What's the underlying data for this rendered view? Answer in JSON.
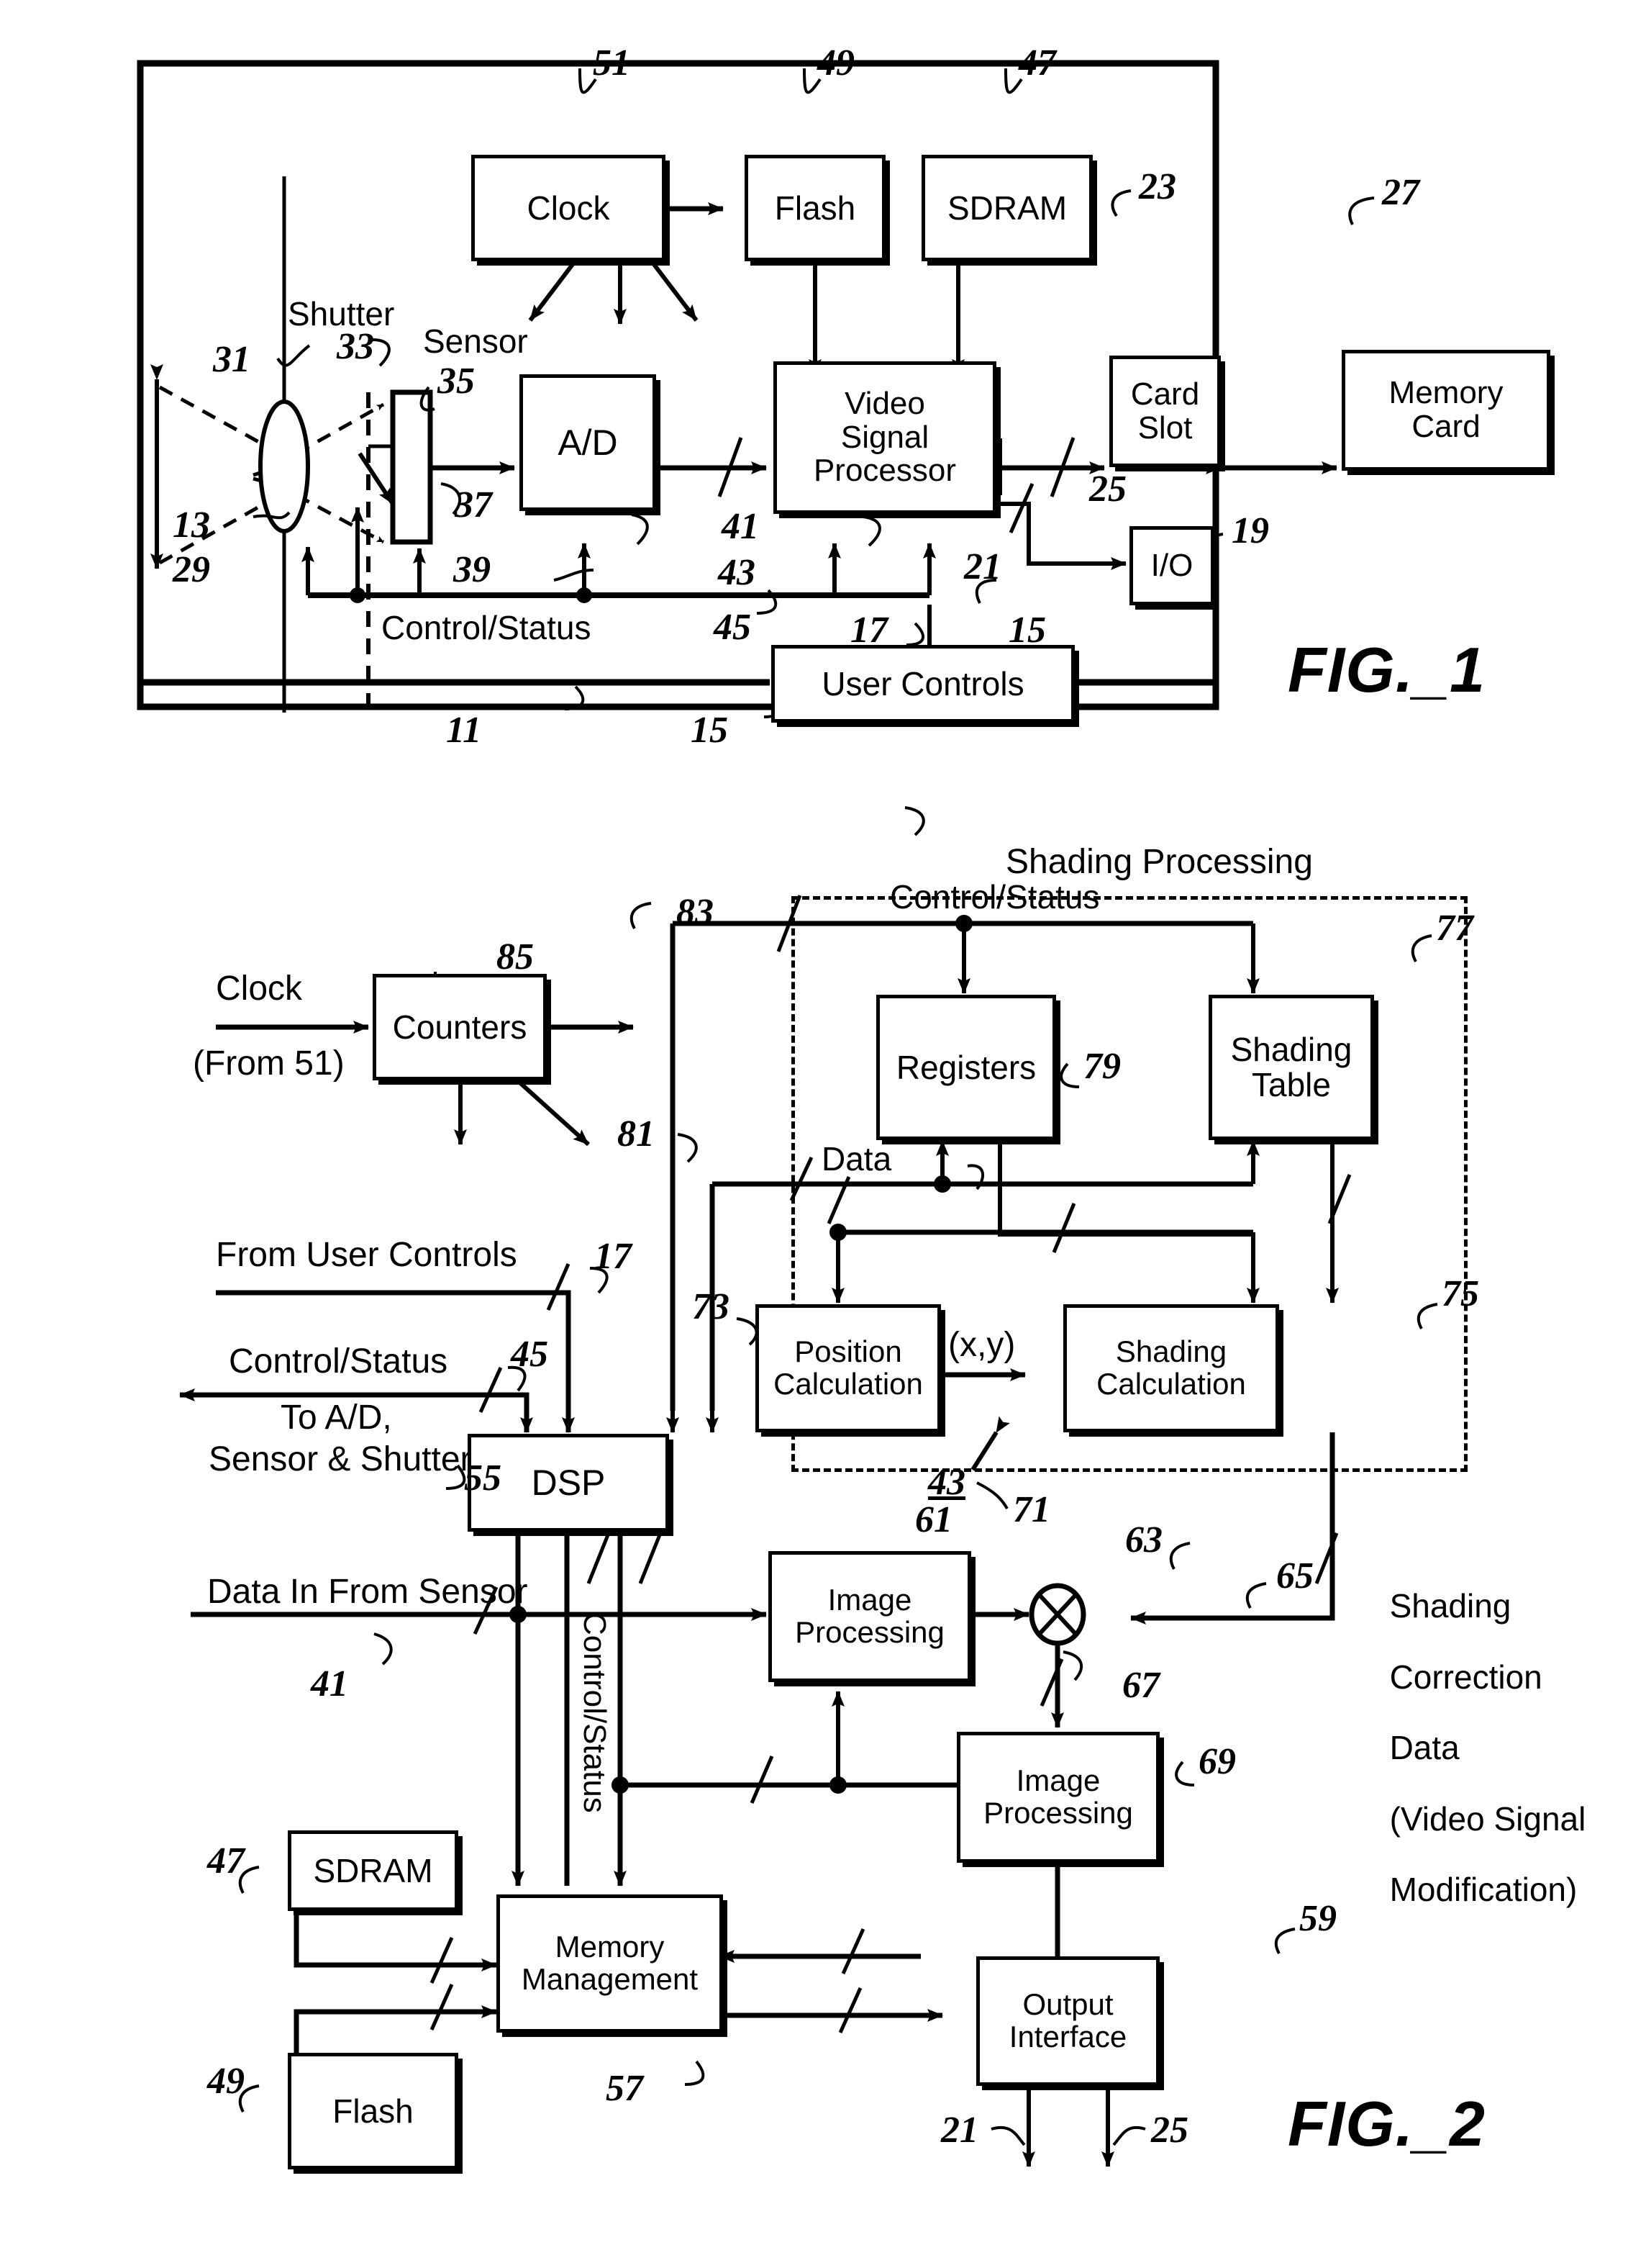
{
  "figures": [
    {
      "id": "fig1",
      "caption": "FIG._1",
      "blocks": {
        "clock": "Clock",
        "flash": "Flash",
        "sdram": "SDRAM",
        "ad": "A/D",
        "video_signal_processor": "Video\nSignal\nProcessor",
        "card_slot": "Card\nSlot",
        "memory_card": "Memory\nCard",
        "io": "I/O",
        "user_controls": "User Controls"
      },
      "labels": {
        "shutter": "Shutter",
        "sensor": "Sensor",
        "control_status": "Control/Status"
      },
      "refs": [
        "51",
        "49",
        "47",
        "23",
        "27",
        "19",
        "31",
        "33",
        "35",
        "13",
        "29",
        "37",
        "39",
        "41",
        "43",
        "45",
        "21",
        "25",
        "17",
        "15",
        "15",
        "11",
        "15"
      ]
    },
    {
      "id": "fig2",
      "caption": "FIG._2",
      "blocks": {
        "counters": "Counters",
        "registers": "Registers",
        "shading_table": "Shading\nTable",
        "position_calculation": "Position\nCalculation",
        "shading_calculation": "Shading\nCalculation",
        "dsp": "DSP",
        "image_processing_1": "Image\nProcessing",
        "image_processing_2": "Image\nProcessing",
        "sdram": "SDRAM",
        "flash": "Flash",
        "memory_management": "Memory\nManagement",
        "output_interface": "Output\nInterface"
      },
      "labels": {
        "shading_processing": "Shading Processing",
        "control_status_top": "Control/Status",
        "data": "Data",
        "xy": "(x,y)",
        "clock": "Clock",
        "clock_from": "(From 51)",
        "from_user_controls": "From User Controls",
        "control_status_out": "Control/Status",
        "to_ad": "To A/D,",
        "sensor_shutter": "Sensor & Shutter",
        "data_in_from_sensor": "Data In From Sensor",
        "control_status_vertical": "Control/Status",
        "shading_correction_data": "Shading\nCorrection\nData\n(Video Signal\nModification)"
      },
      "refs": [
        "83",
        "85",
        "77",
        "79",
        "81",
        "17",
        "75",
        "73",
        "45",
        "55",
        "43",
        "71",
        "61",
        "63",
        "65",
        "41",
        "67",
        "69",
        "47",
        "49",
        "59",
        "57",
        "21",
        "25"
      ]
    }
  ],
  "fig1": {
    "blocks": {
      "clock": "Clock",
      "flash": "Flash",
      "sdram": "SDRAM",
      "ad": "A/D",
      "vsp_line1": "Video",
      "vsp_line2": "Signal",
      "vsp_line3": "Processor",
      "card_slot_line1": "Card",
      "card_slot_line2": "Slot",
      "memory_card_line1": "Memory",
      "memory_card_line2": "Card",
      "io": "I/O",
      "user_controls": "User Controls"
    },
    "text": {
      "shutter": "Shutter",
      "sensor": "Sensor",
      "control_status": "Control/Status"
    },
    "refs": {
      "r51": "51",
      "r49": "49",
      "r47": "47",
      "r23": "23",
      "r27": "27",
      "r19": "19",
      "r31": "31",
      "r33": "33",
      "r35": "35",
      "r13": "13",
      "r29": "29",
      "r37": "37",
      "r39": "39",
      "r41": "41",
      "r43": "43",
      "r45": "45",
      "r21": "21",
      "r25": "25",
      "r17": "17",
      "r15a": "15",
      "r15b": "15",
      "r15c": "15",
      "r11": "11"
    },
    "caption": "FIG._1"
  },
  "fig2": {
    "blocks": {
      "counters": "Counters",
      "registers": "Registers",
      "shading_table_l1": "Shading",
      "shading_table_l2": "Table",
      "position_calc_l1": "Position",
      "position_calc_l2": "Calculation",
      "shading_calc_l1": "Shading",
      "shading_calc_l2": "Calculation",
      "dsp": "DSP",
      "image_proc1_l1": "Image",
      "image_proc1_l2": "Processing",
      "image_proc2_l1": "Image",
      "image_proc2_l2": "Processing",
      "sdram": "SDRAM",
      "flash": "Flash",
      "memory_mgmt_l1": "Memory",
      "memory_mgmt_l2": "Management",
      "output_if_l1": "Output",
      "output_if_l2": "Interface"
    },
    "text": {
      "shading_processing": "Shading Processing",
      "control_status_top": "Control/Status",
      "data": "Data",
      "xy": "(x,y)",
      "clock": "Clock",
      "clock_from": "(From 51)",
      "from_user_controls": "From User Controls",
      "control_status_out": "Control/Status",
      "to_ad": "To A/D,",
      "sensor_shutter": "Sensor & Shutter",
      "data_in_from_sensor": "Data In From Sensor",
      "control_status_vertical": "Control/Status",
      "scd_l1": "Shading",
      "scd_l2": "Correction",
      "scd_l3": "Data",
      "scd_l4": "(Video Signal",
      "scd_l5": "Modification)"
    },
    "refs": {
      "r83": "83",
      "r85": "85",
      "r77": "77",
      "r79": "79",
      "r81": "81",
      "r17": "17",
      "r75": "75",
      "r73": "73",
      "r45": "45",
      "r55": "55",
      "r43": "43",
      "r71": "71",
      "r61": "61",
      "r63": "63",
      "r65": "65",
      "r41": "41",
      "r67": "67",
      "r69": "69",
      "r47": "47",
      "r49": "49",
      "r59": "59",
      "r57": "57",
      "r21": "21",
      "r25": "25"
    },
    "caption": "FIG._2"
  }
}
